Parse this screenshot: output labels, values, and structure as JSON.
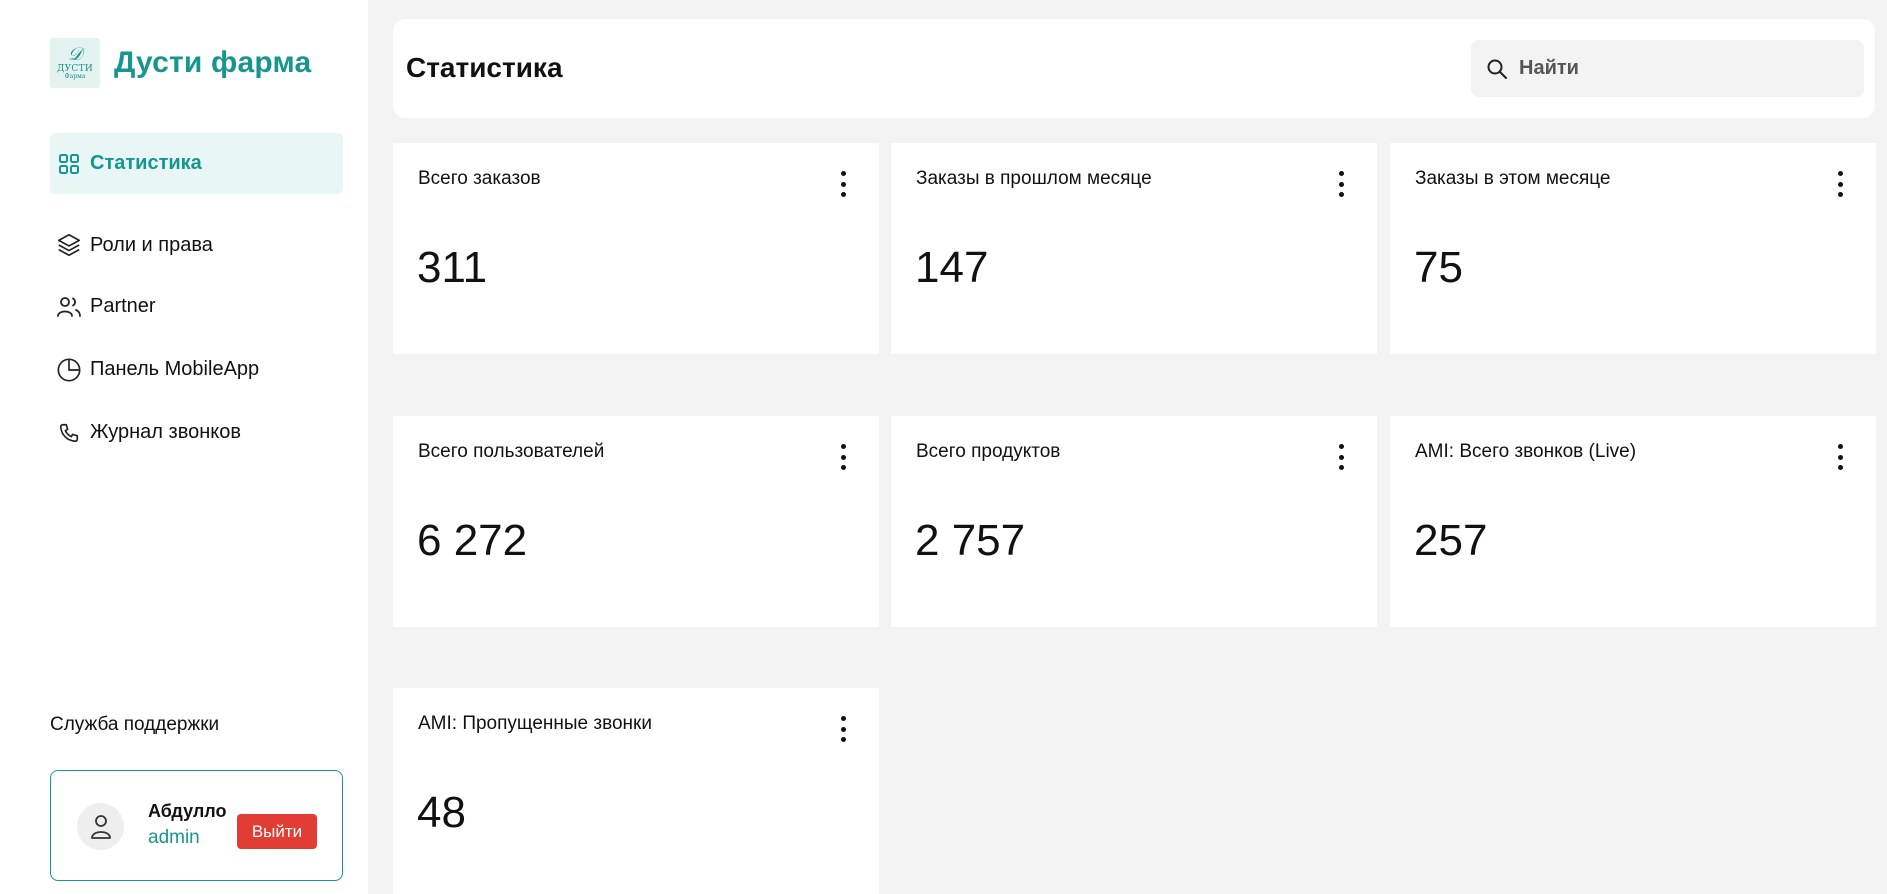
{
  "brand": {
    "name": "Дусти фарма",
    "logo_line1": "ДУСТИ",
    "logo_line2": "Фарма",
    "accent_color": "#16968f"
  },
  "nav": {
    "items": [
      {
        "label": "Статистика",
        "icon": "dashboard-grid-icon",
        "active": true
      },
      {
        "label": "Роли и права",
        "icon": "layers-icon",
        "active": false
      },
      {
        "label": "Partner",
        "icon": "users-icon",
        "active": false
      },
      {
        "label": "Панель MobileApp",
        "icon": "pie-chart-icon",
        "active": false
      },
      {
        "label": "Журнал звонков",
        "icon": "phone-icon",
        "active": false
      }
    ]
  },
  "support": {
    "label": "Служба поддержки"
  },
  "user": {
    "name": "Абдулло",
    "role": "admin",
    "logout_label": "Выйти",
    "logout_color": "#e23d34"
  },
  "header": {
    "title": "Статистика",
    "search_placeholder": "Найти"
  },
  "cards": [
    {
      "title": "Всего заказов",
      "value": "311"
    },
    {
      "title": "Заказы в прошлом месяце",
      "value": "147"
    },
    {
      "title": "Заказы в этом месяце",
      "value": "75"
    },
    {
      "title": "Всего пользователей",
      "value": "6 272"
    },
    {
      "title": "Всего продуктов",
      "value": "2 757"
    },
    {
      "title": "AMI: Всего звонков (Live)",
      "value": "257"
    },
    {
      "title": "AMI: Пропущенные звонки",
      "value": "48"
    }
  ]
}
